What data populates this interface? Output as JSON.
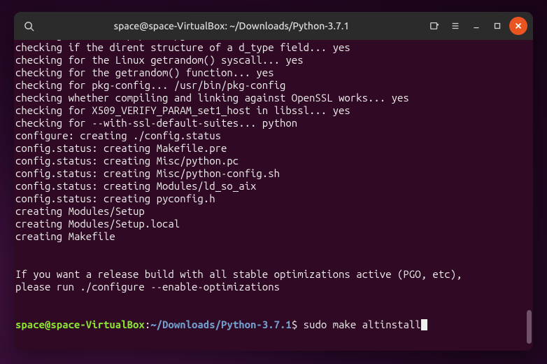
{
  "titlebar": {
    "title": "space@space-VirtualBox: ~/Downloads/Python-3.7.1"
  },
  "terminal": {
    "lines": [
      "checking for ensurepip... upgrade",
      "checking if the dirent structure of a d_type field... yes",
      "checking for the Linux getrandom() syscall... yes",
      "checking for the getrandom() function... yes",
      "checking for pkg-config... /usr/bin/pkg-config",
      "checking whether compiling and linking against OpenSSL works... yes",
      "checking for X509_VERIFY_PARAM_set1_host in libssl... yes",
      "checking for --with-ssl-default-suites... python",
      "configure: creating ./config.status",
      "config.status: creating Makefile.pre",
      "config.status: creating Misc/python.pc",
      "config.status: creating Misc/python-config.sh",
      "config.status: creating Modules/ld_so_aix",
      "config.status: creating pyconfig.h",
      "creating Modules/Setup",
      "creating Modules/Setup.local",
      "creating Makefile",
      "",
      "",
      "If you want a release build with all stable optimizations active (PGO, etc),",
      "please run ./configure --enable-optimizations",
      "",
      ""
    ],
    "prompt": {
      "user": "space@space-VirtualBox",
      "colon": ":",
      "path": "~/Downloads/Python-3.7.1",
      "dollar": "$ ",
      "command": "sudo make altinstall"
    }
  }
}
